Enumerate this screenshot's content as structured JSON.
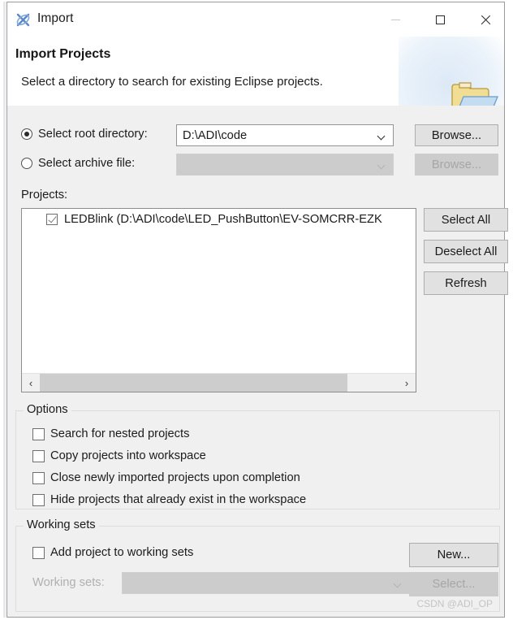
{
  "window": {
    "title": "Import",
    "app_icon": "eclipse-import-icon",
    "minimize_label": "Minimize",
    "maximize_label": "Maximize",
    "close_label": "Close"
  },
  "header": {
    "title": "Import Projects",
    "description": "Select a directory to search for existing Eclipse projects.",
    "icon": "open-folder-icon"
  },
  "source": {
    "root_directory": {
      "label": "Select root directory:",
      "selected": true,
      "value": "D:\\ADI\\code",
      "browse_label": "Browse...",
      "browse_enabled": true
    },
    "archive_file": {
      "label": "Select archive file:",
      "selected": false,
      "value": "",
      "browse_label": "Browse...",
      "browse_enabled": false
    }
  },
  "projects": {
    "label": "Projects:",
    "items": [
      {
        "checked": true,
        "text": "LEDBlink (D:\\ADI\\code\\LED_PushButton\\EV-SOMCRR-EZK"
      }
    ],
    "buttons": {
      "select_all": "Select All",
      "deselect_all": "Deselect All",
      "refresh": "Refresh"
    },
    "scrollbar": {
      "left_arrow": "‹",
      "right_arrow": "›"
    }
  },
  "options": {
    "title": "Options",
    "items": [
      {
        "label": "Search for nested projects",
        "checked": false
      },
      {
        "label": "Copy projects into workspace",
        "checked": false
      },
      {
        "label": "Close newly imported projects upon completion",
        "checked": false
      },
      {
        "label": "Hide projects that already exist in the workspace",
        "checked": false
      }
    ]
  },
  "working_sets": {
    "title": "Working sets",
    "add_checkbox": {
      "label": "Add project to working sets",
      "checked": false
    },
    "new_button": {
      "label": "New...",
      "enabled": true
    },
    "combo": {
      "label": "Working sets:",
      "value": "",
      "enabled": false
    },
    "select_button": {
      "label": "Select...",
      "enabled": false
    }
  },
  "watermark": "CSDN @ADI_OP",
  "colors": {
    "dialog_bg": "#f0f0f0",
    "header_bg": "#ffffff",
    "field_bg": "#ffffff",
    "button_bg": "#e1e1e1",
    "disabled_bg": "#cccccc",
    "text": "#1b1b1b",
    "disabled_text": "#a6a6a6",
    "folder_yellow": "#efd27a",
    "folder_blue": "#bcd8f0"
  }
}
